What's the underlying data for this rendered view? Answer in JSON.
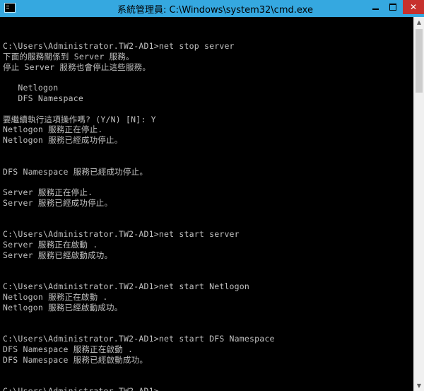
{
  "window": {
    "title": "系統管理員: C:\\Windows\\system32\\cmd.exe",
    "controls": {
      "minimize": "",
      "maximize": "",
      "close": "✕"
    }
  },
  "console": {
    "lines": [
      "C:\\Users\\Administrator.TW2-AD1>net stop server",
      "下面的服務關係到 Server 服務。",
      "停止 Server 服務也會停止這些服務。",
      "",
      "   Netlogon",
      "   DFS Namespace",
      "",
      "要繼續執行這項操作嗎? (Y/N) [N]: Y",
      "Netlogon 服務正在停止.",
      "Netlogon 服務已經成功停止。",
      "",
      "",
      "DFS Namespace 服務已經成功停止。",
      "",
      "Server 服務正在停止.",
      "Server 服務已經成功停止。",
      "",
      "",
      "C:\\Users\\Administrator.TW2-AD1>net start server",
      "Server 服務正在啟動 .",
      "Server 服務已經啟動成功。",
      "",
      "",
      "C:\\Users\\Administrator.TW2-AD1>net start Netlogon",
      "Netlogon 服務正在啟動 .",
      "Netlogon 服務已經啟動成功。",
      "",
      "",
      "C:\\Users\\Administrator.TW2-AD1>net start DFS Namespace",
      "DFS Namespace 服務正在啟動 .",
      "DFS Namespace 服務已經啟動成功。",
      "",
      "",
      "C:\\Users\\Administrator.TW2-AD1>"
    ]
  },
  "colors": {
    "titlebar": "#35a8e0",
    "close_button": "#c7312d",
    "console_background": "#000000",
    "console_text": "#c0c0c0"
  },
  "icons": {
    "window_icon": "cmd-icon",
    "scroll_up": "▲",
    "scroll_down": "▼"
  }
}
